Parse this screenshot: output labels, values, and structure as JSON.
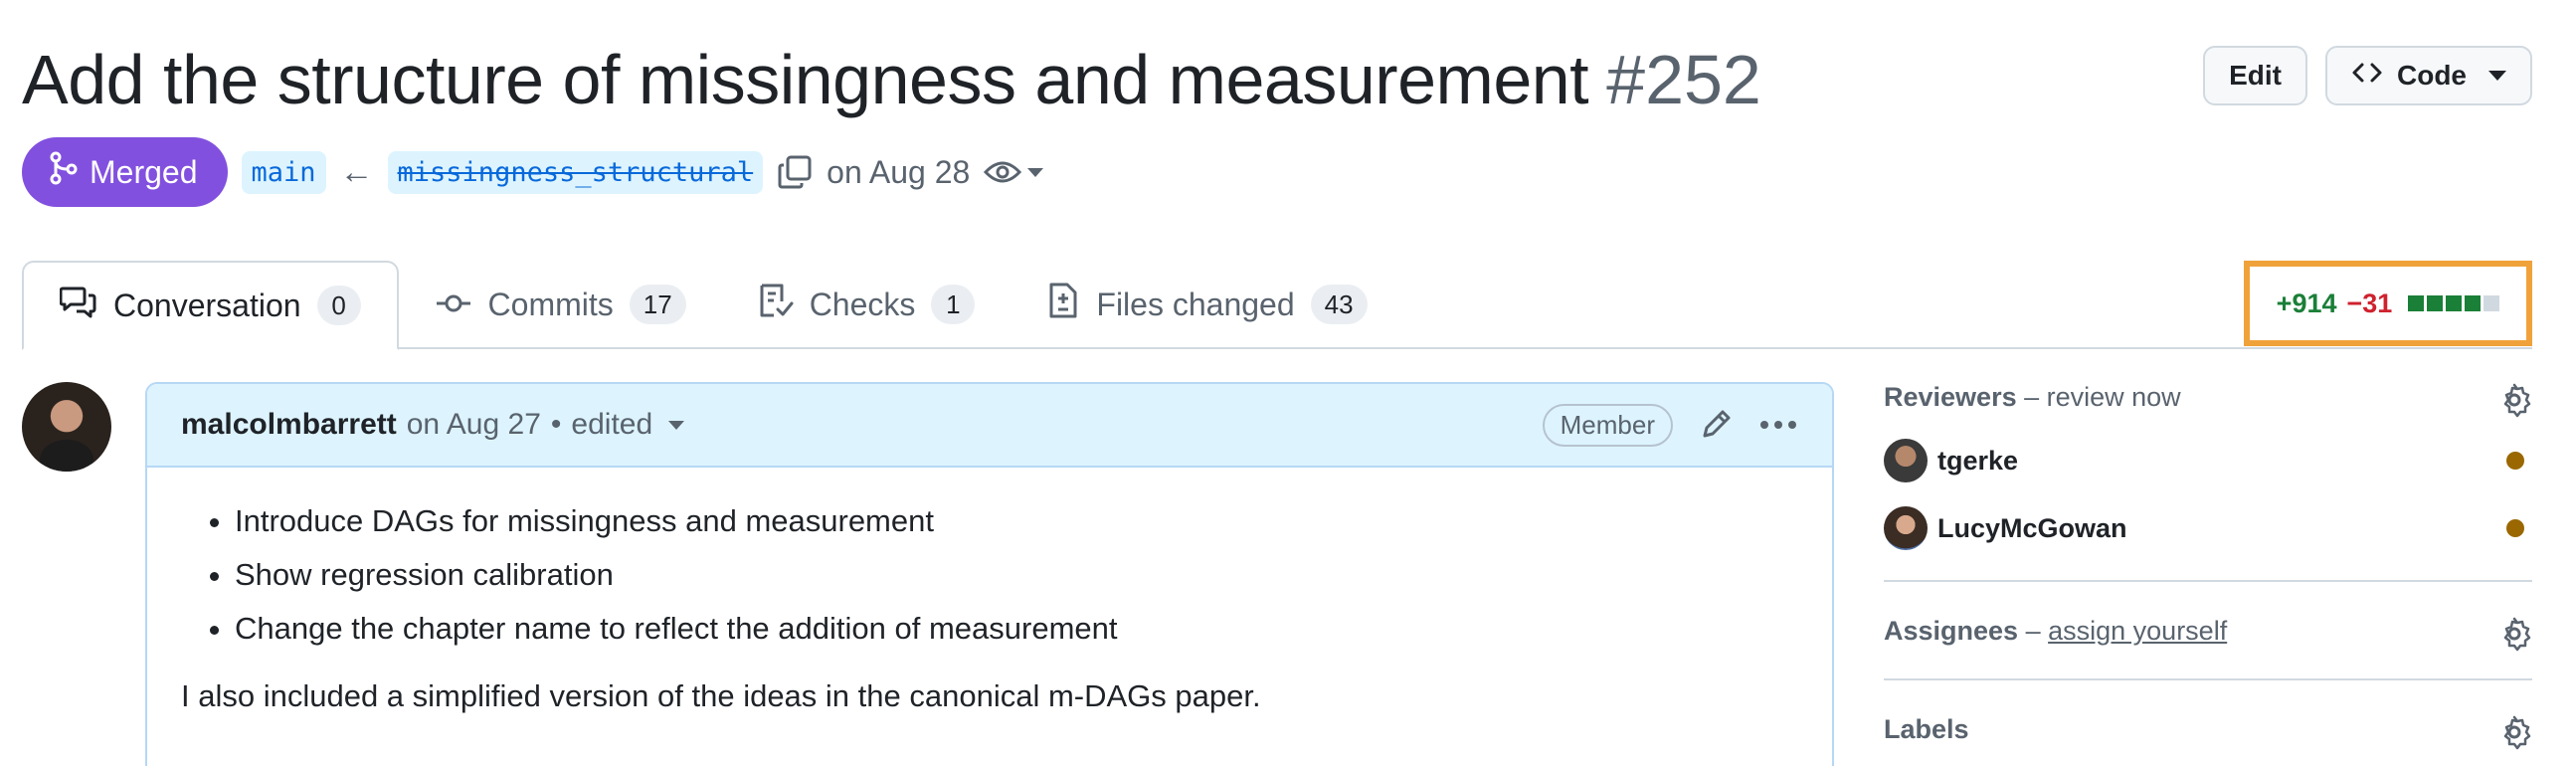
{
  "pr": {
    "title": "Add the structure of missingness and measurement",
    "number": "#252",
    "state": "Merged",
    "state_color": "#8250df",
    "base_branch": "main",
    "head_branch": "missingness_structural",
    "arrow": "←",
    "date_text": "on Aug 28"
  },
  "header_actions": {
    "edit_label": "Edit",
    "code_label": "Code"
  },
  "tabs": [
    {
      "label": "Conversation",
      "count": "0",
      "icon": "comment-discussion-icon"
    },
    {
      "label": "Commits",
      "count": "17",
      "icon": "commit-icon"
    },
    {
      "label": "Checks",
      "count": "1",
      "icon": "checklist-icon"
    },
    {
      "label": "Files changed",
      "count": "43",
      "icon": "file-diff-icon"
    }
  ],
  "diffstat": {
    "additions": "+914",
    "deletions": "−31",
    "blocks": [
      "#1a7f37",
      "#1a7f37",
      "#1a7f37",
      "#1a7f37",
      "#d1d9e0"
    ]
  },
  "comment": {
    "author": "malcolmbarrett",
    "date": "on Aug 27",
    "separator": "•",
    "edited": "edited",
    "badge": "Member",
    "bullets": [
      "Introduce DAGs for missingness and measurement",
      "Show regression calibration",
      "Change the chapter name to reflect the addition of measurement"
    ],
    "paragraph": "I also included a simplified version of the ideas in the canonical m-DAGs paper."
  },
  "sidebar": {
    "reviewers": {
      "heading": "Reviewers",
      "sub": " – review now",
      "people": [
        {
          "name": "tgerke",
          "status_color": "#9a6700"
        },
        {
          "name": "LucyMcGowan",
          "status_color": "#9a6700"
        }
      ]
    },
    "assignees": {
      "heading": "Assignees",
      "dash": " – ",
      "link": "assign yourself"
    },
    "labels": {
      "heading": "Labels"
    }
  }
}
